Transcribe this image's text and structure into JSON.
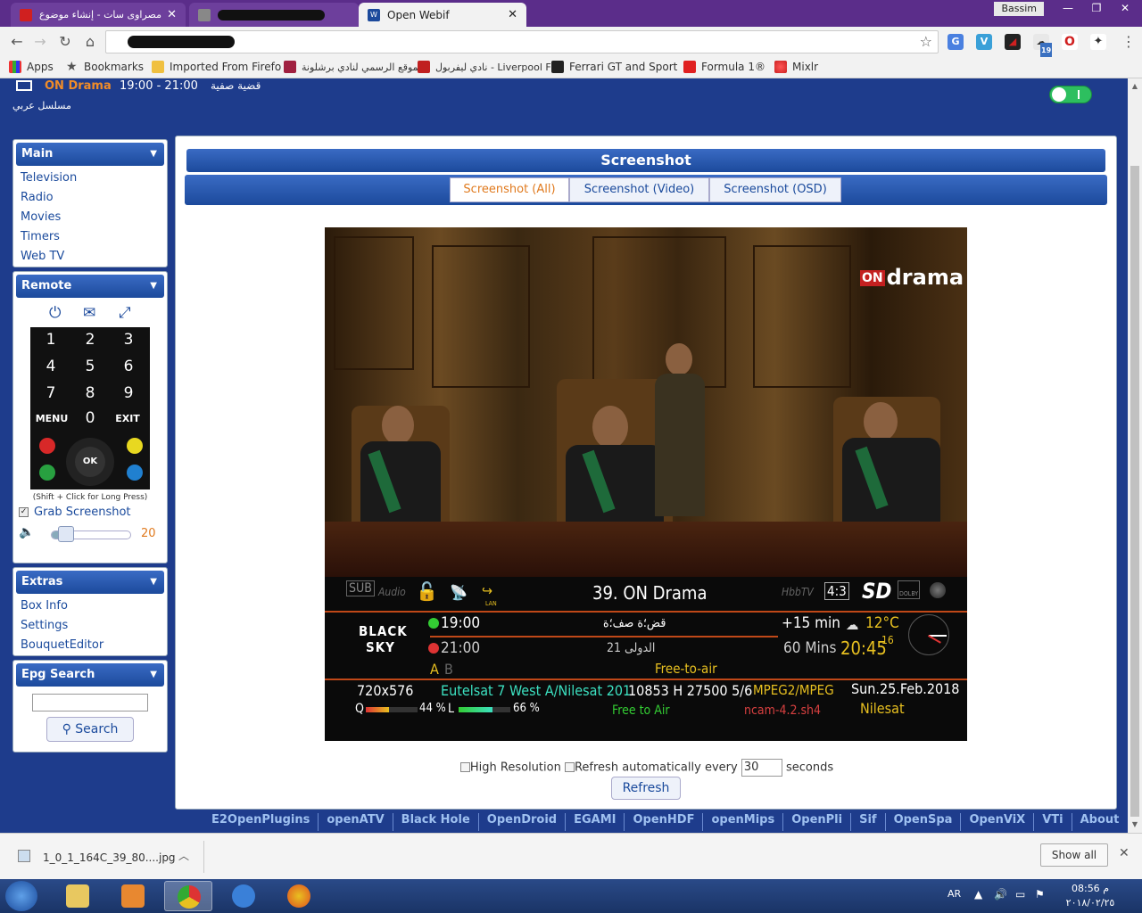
{
  "browser": {
    "tabs": [
      {
        "label": "مصراوى سات - إنشاء موضوع",
        "active": false
      },
      {
        "label": "",
        "active": false
      },
      {
        "label": "Open Webif",
        "active": true
      }
    ],
    "profile": "Bassim",
    "bookmarks": [
      {
        "label": "Apps",
        "icon": "apps-grid-icon"
      },
      {
        "label": "Bookmarks",
        "icon": "star-icon"
      },
      {
        "label": "Imported From Firefo",
        "icon": "folder-icon"
      },
      {
        "label": "الموقع الرسمي لنادي برشلونة",
        "icon": "barcelona-icon"
      },
      {
        "label": "نادي ليفربول - Liverpool FC",
        "icon": "liverpool-icon"
      },
      {
        "label": "Ferrari GT and Sport",
        "icon": "ferrari-icon"
      },
      {
        "label": "Formula 1®",
        "icon": "f1-icon"
      },
      {
        "label": "Mixlr",
        "icon": "mixlr-icon"
      }
    ],
    "extension_badge": "19"
  },
  "header": {
    "channel": "ON Drama",
    "time": "19:00 - 21:00",
    "title": "قضية صفية",
    "genre": "مسلسل عربي"
  },
  "sidebar": {
    "main": {
      "title": "Main",
      "items": [
        "Television",
        "Radio",
        "Movies",
        "Timers",
        "Web TV"
      ]
    },
    "remote": {
      "title": "Remote",
      "keys": [
        "1",
        "2",
        "3",
        "4",
        "5",
        "6",
        "7",
        "8",
        "9",
        "MENU",
        "0",
        "EXIT"
      ],
      "ok_label": "OK",
      "hint": "(Shift + Click for Long Press)",
      "grab_label": "Grab Screenshot",
      "grab_checked": true,
      "volume": 20,
      "volume_label": "20"
    },
    "extras": {
      "title": "Extras",
      "items": [
        "Box Info",
        "Settings",
        "BouquetEditor"
      ]
    },
    "epg": {
      "title": "Epg Search",
      "search_label": "Search"
    }
  },
  "main": {
    "title": "Screenshot",
    "tabs": [
      "Screenshot (All)",
      "Screenshot (Video)",
      "Screenshot (OSD)"
    ],
    "active_tab": 0,
    "osd": {
      "logo_on": "ON",
      "logo_text": "drama",
      "sub": "SUB",
      "audio": "Audio",
      "lan": "LAN",
      "channel_line": "39. ON Drama",
      "hbbtv": "HbbTV",
      "aspect": "4:3",
      "sd": "SD",
      "dolby": "DOLBY",
      "skin_line1": "BLACK",
      "skin_line2": "SKY",
      "now_time": "19:00",
      "now_title": "قض؛ة صف؛ة",
      "now_remaining": "+15 min",
      "next_time": "21:00",
      "next_title": "الدولى 21",
      "next_duration": "60 Mins",
      "audio_a": "A",
      "audio_b": "B",
      "fta": "Free-to-air",
      "temp": "12°C",
      "clock": "20:45",
      "clock_sec": "16",
      "resolution": "720x576",
      "satellite": "Eutelsat 7 West A/Nilesat 201",
      "tp": "10853 H 27500 5/6",
      "codec": "MPEG2/MPEG",
      "date": "Sun.25.Feb.2018",
      "q_label": "Q",
      "q_value": "44 %",
      "q_level": 44,
      "l_label": "L",
      "l_value": "66 %",
      "l_level": 66,
      "free_to_air": "Free to Air",
      "cam": "ncam-4.2.sh4",
      "provider": "Nilesat"
    },
    "form": {
      "high_res_label": "High Resolution",
      "auto_refresh_label": "Refresh automatically every",
      "interval": "30",
      "seconds_label": "seconds",
      "refresh_label": "Refresh"
    }
  },
  "footer_links": [
    "E2OpenPlugins",
    "openATV",
    "Black Hole",
    "OpenDroid",
    "EGAMI",
    "OpenHDF",
    "openMips",
    "OpenPli",
    "Sif",
    "OpenSpa",
    "OpenViX",
    "VTi",
    "About"
  ],
  "download": {
    "file": "1_0_1_164C_39_80....jpg",
    "show_all": "Show all"
  },
  "taskbar": {
    "lang": "AR",
    "time": "08:56 م",
    "date": "٢٠١٨/٠٢/٢٥"
  }
}
